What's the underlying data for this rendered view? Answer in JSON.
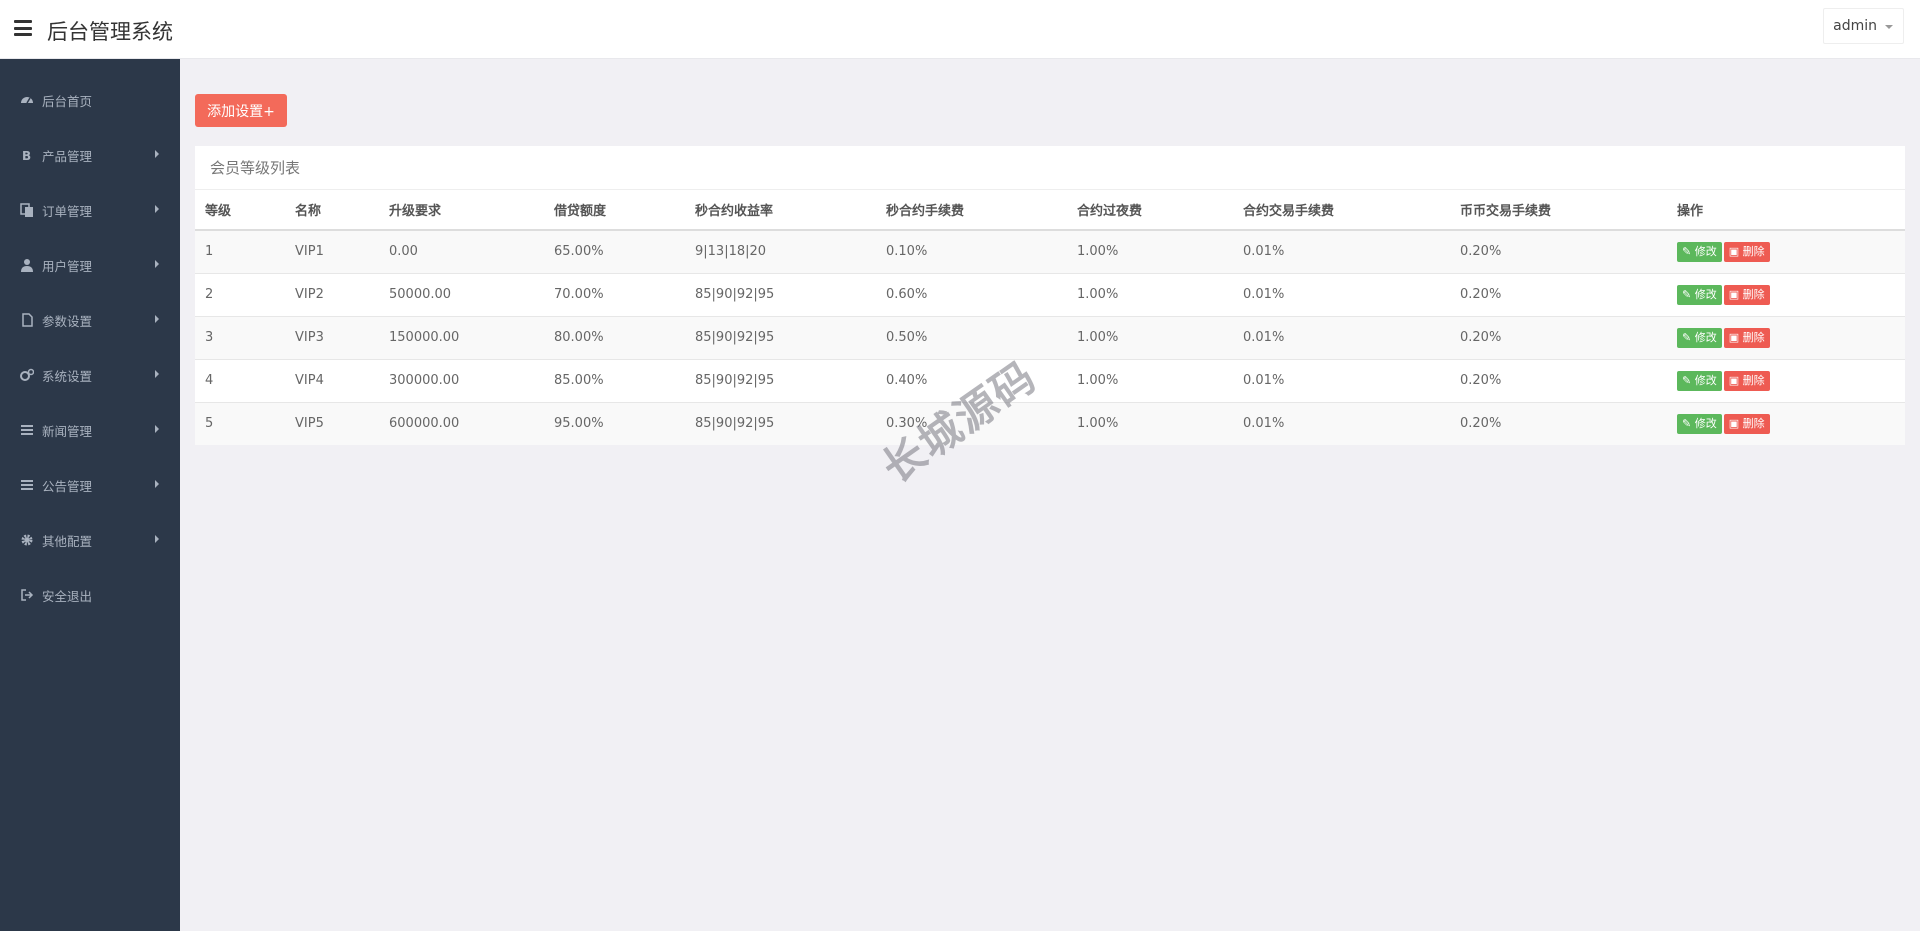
{
  "header": {
    "title": "后台管理系统",
    "user": "admin"
  },
  "sidebar": {
    "items": [
      {
        "label": "后台首页",
        "icon": "dashboard-icon",
        "has_submenu": false
      },
      {
        "label": "产品管理",
        "icon": "bitcoin-icon",
        "has_submenu": true
      },
      {
        "label": "订单管理",
        "icon": "copy-icon",
        "has_submenu": true
      },
      {
        "label": "用户管理",
        "icon": "user-icon",
        "has_submenu": true
      },
      {
        "label": "参数设置",
        "icon": "file-icon",
        "has_submenu": true
      },
      {
        "label": "系统设置",
        "icon": "gears-icon",
        "has_submenu": true
      },
      {
        "label": "新闻管理",
        "icon": "list-icon",
        "has_submenu": true
      },
      {
        "label": "公告管理",
        "icon": "list-icon",
        "has_submenu": true
      },
      {
        "label": "其他配置",
        "icon": "gear-icon",
        "has_submenu": true
      },
      {
        "label": "安全退出",
        "icon": "sign-out-icon",
        "has_submenu": false
      }
    ]
  },
  "toolbar": {
    "add_label": "添加设置+"
  },
  "panel": {
    "title": "会员等级列表"
  },
  "table": {
    "headers": [
      "等级",
      "名称",
      "升级要求",
      "借贷额度",
      "秒合约收益率",
      "秒合约手续费",
      "合约过夜费",
      "合约交易手续费",
      "币币交易手续费",
      "操作"
    ],
    "rows": [
      [
        "1",
        "VIP1",
        "0.00",
        "65.00%",
        "9|13|18|20",
        "0.10%",
        "1.00%",
        "0.01%",
        "0.20%"
      ],
      [
        "2",
        "VIP2",
        "50000.00",
        "70.00%",
        "85|90|92|95",
        "0.60%",
        "1.00%",
        "0.01%",
        "0.20%"
      ],
      [
        "3",
        "VIP3",
        "150000.00",
        "80.00%",
        "85|90|92|95",
        "0.50%",
        "1.00%",
        "0.01%",
        "0.20%"
      ],
      [
        "4",
        "VIP4",
        "300000.00",
        "85.00%",
        "85|90|92|95",
        "0.40%",
        "1.00%",
        "0.01%",
        "0.20%"
      ],
      [
        "5",
        "VIP5",
        "600000.00",
        "95.00%",
        "85|90|92|95",
        "0.30%",
        "1.00%",
        "0.01%",
        "0.20%"
      ]
    ],
    "edit_label": "修改",
    "delete_label": "删除"
  },
  "watermark": "长城源码",
  "colors": {
    "sidebar_bg": "#2c3849",
    "add_button": "#f36a5a",
    "edit_button": "#5cb85c",
    "delete_button": "#ee5b52"
  }
}
